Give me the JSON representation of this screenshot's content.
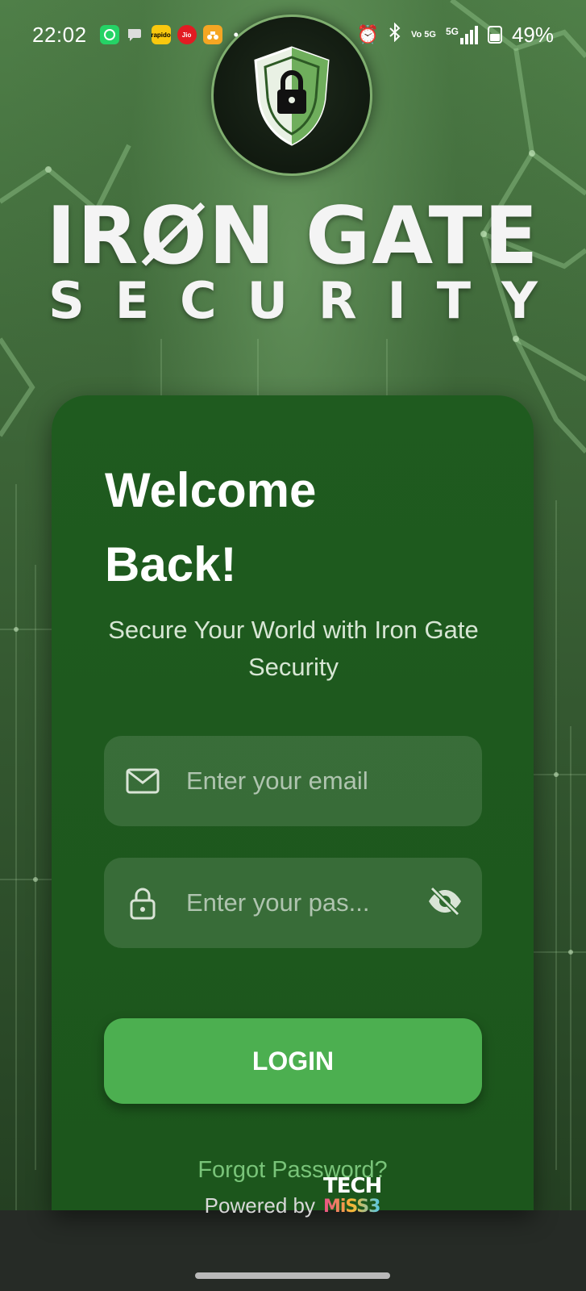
{
  "status_bar": {
    "time": "22:02",
    "battery": "49%",
    "network": "5G",
    "notifications": [
      {
        "name": "whatsapp-icon",
        "color": "#25D366",
        "label": ""
      },
      {
        "name": "chat-icon",
        "color": "#9aa39a",
        "label": ""
      },
      {
        "name": "rapido-icon",
        "color": "#F9C80E",
        "label": "rapido"
      },
      {
        "name": "jio-icon",
        "color": "#E21B22",
        "label": "Jio"
      },
      {
        "name": "scooter-icon",
        "color": "#F5A623",
        "label": ""
      }
    ],
    "vo_label": "Vo 5G"
  },
  "brand": {
    "title": "IRØN GATE",
    "subtitle": "SECURITY",
    "logo_icon": "shield-lock-icon"
  },
  "login": {
    "heading": "Welcome Back!",
    "tagline": "Secure Your World with Iron Gate Security",
    "email_placeholder": "Enter your email",
    "password_placeholder": "Enter your pas...",
    "login_label": "LOGIN",
    "forgot_label": "Forgot Password?"
  },
  "footer": {
    "powered_by": "Powered by",
    "brand_top": "TECH",
    "brand_bottom": "MiSS3"
  },
  "colors": {
    "accent": "#4caf50",
    "card": "#1f5b1f",
    "link": "#79c479"
  }
}
